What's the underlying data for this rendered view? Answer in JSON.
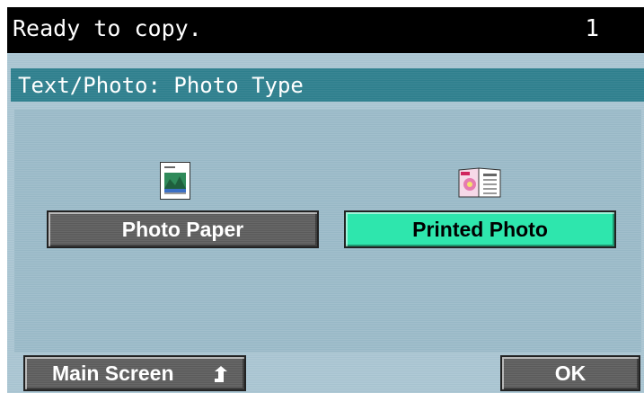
{
  "status_bar": {
    "message": "Ready to copy.",
    "copy_count": "1"
  },
  "title": "Text/Photo: Photo Type",
  "options": [
    {
      "label": "Photo Paper",
      "icon": "photo-paper-icon",
      "selected": false
    },
    {
      "label": "Printed Photo",
      "icon": "printed-photo-icon",
      "selected": true
    }
  ],
  "footer": {
    "main_screen_label": "Main Screen",
    "ok_label": "OK"
  },
  "colors": {
    "status_bar_bg": "#000000",
    "title_bar_bg": "#2e7f8d",
    "panel_bg": "#98b8c6",
    "selected_button": "#2ee6ad",
    "unselected_button": "#5b5b5b"
  }
}
